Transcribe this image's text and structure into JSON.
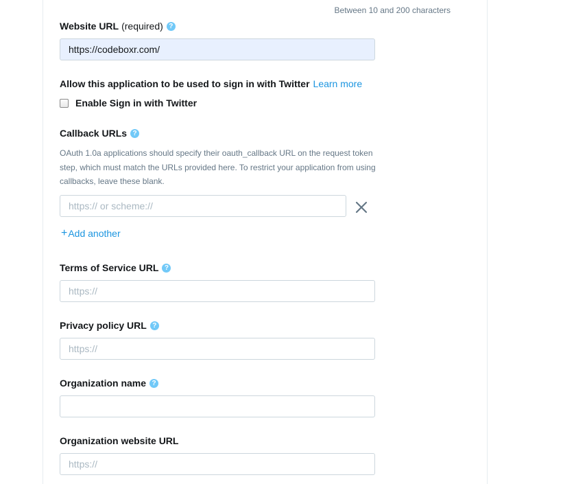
{
  "form": {
    "length_hint": "Between 10 and 200 characters",
    "website_url": {
      "label": "Website URL",
      "label_suffix": "(required)",
      "value": "https://codeboxr.com/"
    },
    "sign_in": {
      "heading": "Allow this application to be used to sign in with Twitter",
      "learn_more": "Learn more",
      "checkbox_label": "Enable Sign in with Twitter",
      "checked": false
    },
    "callback": {
      "label": "Callback URLs",
      "description": "OAuth 1.0a applications should specify their oauth_callback URL on the request token step, which must match the URLs provided here. To restrict your application from using callbacks, leave these blank.",
      "placeholder": "https:// or scheme://",
      "add_another": "Add another"
    },
    "terms_url": {
      "label": "Terms of Service URL",
      "placeholder": "https://"
    },
    "privacy_url": {
      "label": "Privacy policy URL",
      "placeholder": "https://"
    },
    "org_name": {
      "label": "Organization name",
      "placeholder": ""
    },
    "org_website": {
      "label": "Organization website URL",
      "placeholder": "https://"
    }
  },
  "icons": {
    "help": "question-mark-circle-icon",
    "remove": "close-icon",
    "add": "plus-icon"
  },
  "colors": {
    "link": "#1b95e0",
    "help_badge": "#71c9f8",
    "autofill_bg": "#e8f0fe",
    "border": "#ccd6dd"
  }
}
